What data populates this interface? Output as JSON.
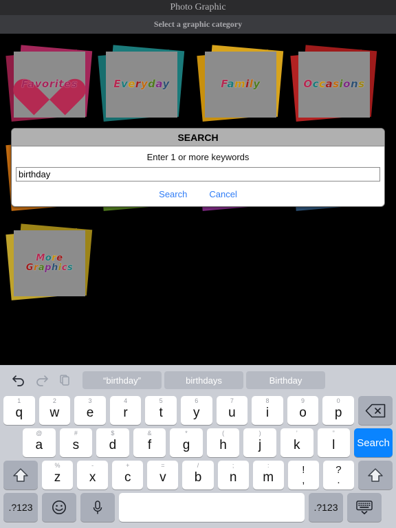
{
  "window": {
    "title": "Photo Graphic",
    "subtitle": "Select a graphic category"
  },
  "grid": {
    "tiles": [
      {
        "label": "Favorites",
        "color": "#a3275a",
        "back1": "#8f1d45",
        "back2": "#a3275a",
        "heart": true
      },
      {
        "label": "Everyday",
        "color": "#1b7b7b",
        "back1": "#176e6e",
        "back2": "#1b7b7b",
        "heart": false
      },
      {
        "label": "Family",
        "color": "#c8900e",
        "back1": "#c8900e",
        "back2": "#d8a41c",
        "heart": false
      },
      {
        "label": "Occasions",
        "color": "#9e1b1b",
        "back1": "#b22222",
        "back2": "#9e1b1b",
        "heart": false
      },
      {
        "label": "",
        "color": "#c06a10",
        "back1": "#c06a10",
        "back2": "#b25f0b",
        "heart": false
      },
      {
        "label": "",
        "color": "#4f7a1e",
        "back1": "#4f7a1e",
        "back2": "#5d8b27",
        "heart": false
      },
      {
        "label": "",
        "color": "#7d2a83",
        "back1": "#7d2a83",
        "back2": "#8d3494",
        "heart": false
      },
      {
        "label": "",
        "color": "#2b4f72",
        "back1": "#2b4f72",
        "back2": "#345c84",
        "heart": false
      },
      {
        "label": "More Graphics",
        "color": "#9c8418",
        "back1": "#bfa32c",
        "back2": "#9c8418",
        "heart": false
      }
    ]
  },
  "dialog": {
    "title": "SEARCH",
    "prompt": "Enter 1 or more keywords",
    "input_value": "birthday",
    "input_placeholder": "",
    "search_label": "Search",
    "cancel_label": "Cancel"
  },
  "keyboard": {
    "toolbar": {
      "undo_icon": "undo-icon",
      "redo_icon": "redo-icon",
      "paste_icon": "paste-icon"
    },
    "suggestions": [
      "“birthday”",
      "birthdays",
      "Birthday"
    ],
    "row1": [
      {
        "key": "q",
        "hint": "1"
      },
      {
        "key": "w",
        "hint": "2"
      },
      {
        "key": "e",
        "hint": "3"
      },
      {
        "key": "r",
        "hint": "4"
      },
      {
        "key": "t",
        "hint": "5"
      },
      {
        "key": "y",
        "hint": "6"
      },
      {
        "key": "u",
        "hint": "7"
      },
      {
        "key": "i",
        "hint": "8"
      },
      {
        "key": "o",
        "hint": "9"
      },
      {
        "key": "p",
        "hint": "0"
      }
    ],
    "row2": [
      {
        "key": "a",
        "hint": "@"
      },
      {
        "key": "s",
        "hint": "#"
      },
      {
        "key": "d",
        "hint": "$"
      },
      {
        "key": "f",
        "hint": "&"
      },
      {
        "key": "g",
        "hint": "*"
      },
      {
        "key": "h",
        "hint": "("
      },
      {
        "key": "j",
        "hint": ")"
      },
      {
        "key": "k",
        "hint": "’"
      },
      {
        "key": "l",
        "hint": "”"
      }
    ],
    "row3": [
      {
        "key": "z",
        "hint": "%"
      },
      {
        "key": "x",
        "hint": "-"
      },
      {
        "key": "c",
        "hint": "+"
      },
      {
        "key": "v",
        "hint": "="
      },
      {
        "key": "b",
        "hint": "/"
      },
      {
        "key": "n",
        "hint": ";"
      },
      {
        "key": "m",
        "hint": ":"
      }
    ],
    "punct": [
      {
        "top": "!",
        "bottom": ","
      },
      {
        "top": "?",
        "bottom": "."
      }
    ],
    "backspace_icon": "backspace-icon",
    "return_label": "Search",
    "shift_icon": "shift-icon",
    "numeric_label": ".?123",
    "emoji_icon": "emoji-icon",
    "mic_icon": "microphone-icon",
    "space_label": "",
    "dismiss_icon": "dismiss-keyboard-icon"
  }
}
